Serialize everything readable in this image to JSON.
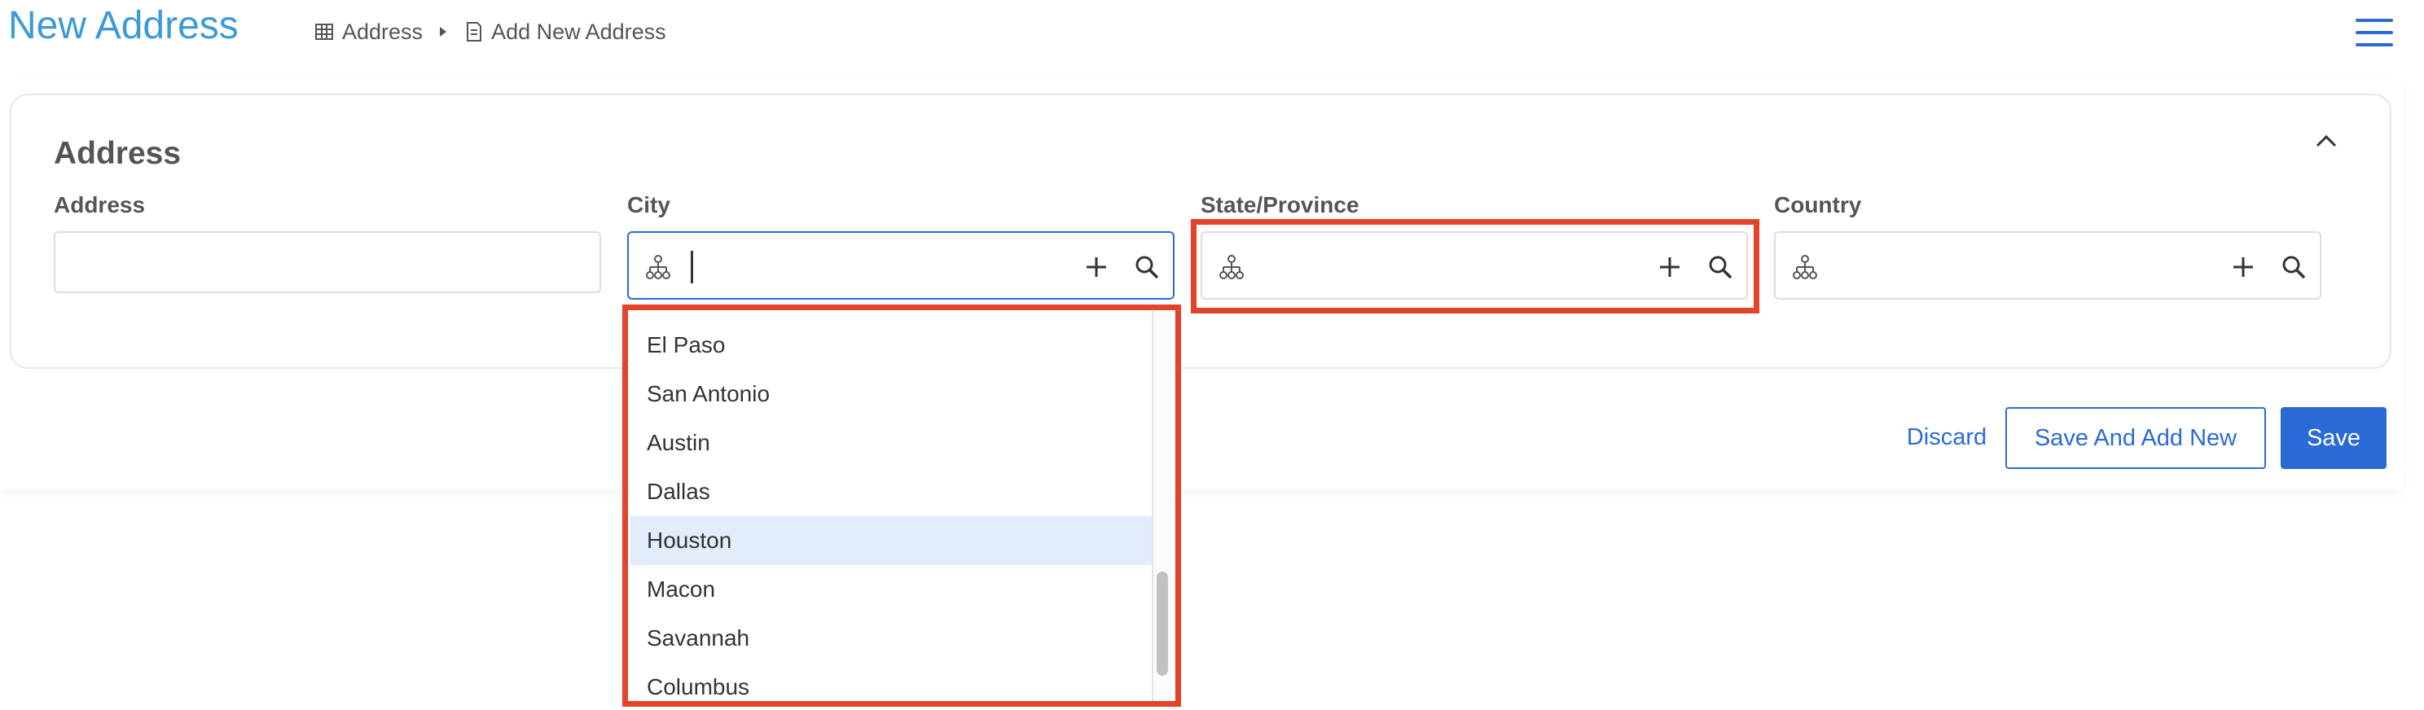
{
  "header": {
    "title": "New Address",
    "breadcrumb": [
      {
        "label": "Address",
        "icon": "table-icon"
      },
      {
        "label": "Add New Address",
        "icon": "document-icon"
      }
    ],
    "menu_icon": "hamburger-menu-icon"
  },
  "form": {
    "section_title": "Address",
    "fields": {
      "address": {
        "label": "Address",
        "value": ""
      },
      "city": {
        "label": "City",
        "value": "",
        "icon": "hierarchy-icon"
      },
      "state": {
        "label": "State/Province",
        "value": "",
        "icon": "hierarchy-icon"
      },
      "country": {
        "label": "Country",
        "value": "",
        "icon": "hierarchy-icon"
      }
    }
  },
  "city_dropdown": {
    "items": [
      "El Paso",
      "San Antonio",
      "Austin",
      "Dallas",
      "Houston",
      "Macon",
      "Savannah",
      "Columbus"
    ],
    "highlighted": "Houston"
  },
  "actions": {
    "discard": "Discard",
    "save_and_add_new": "Save And Add New",
    "save": "Save"
  },
  "colors": {
    "accent": "#2b6ad6",
    "title": "#3d9ad8",
    "highlight_border": "#e24329",
    "active_item_bg": "#e3ecfb"
  }
}
